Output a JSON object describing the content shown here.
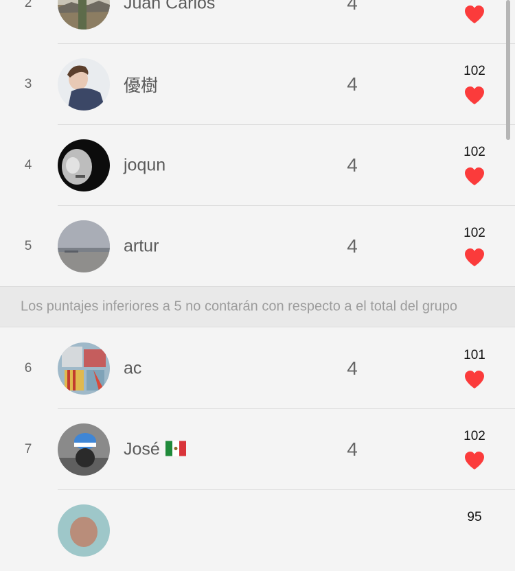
{
  "rows": [
    {
      "rank": "2",
      "name": "Juan Carlos",
      "score": "4",
      "likes": ""
    },
    {
      "rank": "3",
      "name": "優樹",
      "score": "4",
      "likes": "102"
    },
    {
      "rank": "4",
      "name": "joqun",
      "score": "4",
      "likes": "102"
    },
    {
      "rank": "5",
      "name": "artur",
      "score": "4",
      "likes": "102"
    },
    {
      "rank": "6",
      "name": "ac",
      "score": "4",
      "likes": "101"
    },
    {
      "rank": "7",
      "name": "José",
      "score": "4",
      "likes": "102"
    },
    {
      "rank": "",
      "name": "",
      "score": "",
      "likes": "95"
    }
  ],
  "notice": "Los puntajes inferiores a 5 no contarán con respecto a el total del grupo",
  "colors": {
    "heart": "#fb3b3b",
    "background": "#f4f4f4",
    "notice_bg": "#e9e9e9"
  },
  "icons": {
    "like": "heart-icon",
    "flag": "mexico-flag-icon"
  }
}
